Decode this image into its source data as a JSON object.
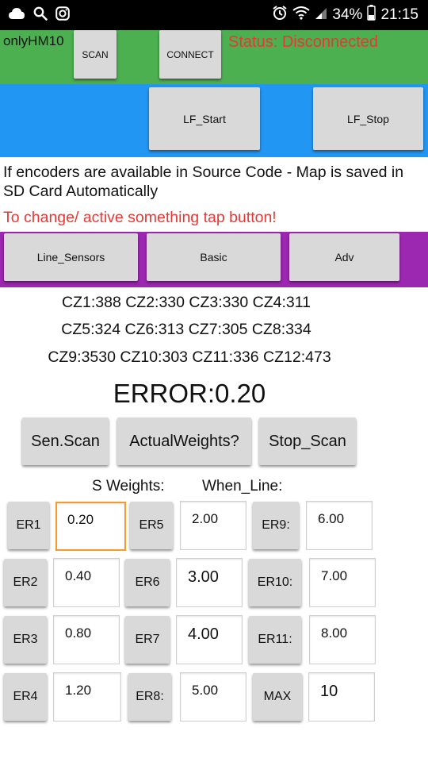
{
  "status_bar": {
    "battery": "34%",
    "time": "21:15",
    "icons": [
      "cloud-icon",
      "search-icon",
      "instagram-icon",
      "alarm-icon",
      "wifi-icon",
      "signal-icon",
      "battery-icon"
    ]
  },
  "top": {
    "device_name": "onlyHM10",
    "scan_label": "SCAN",
    "connect_label": "CONNECT",
    "status_text": "Status: Disconnected"
  },
  "control": {
    "lf_start_label": "LF_Start",
    "lf_stop_label": "LF_Stop"
  },
  "info": {
    "text": "If  encoders are available in Source Code - Map is saved in SD Card Automatically",
    "hint": "To change/ active something tap button!"
  },
  "tabs": {
    "line_sensors": "Line_Sensors",
    "basic": "Basic",
    "adv": "Adv"
  },
  "readings": {
    "row1": "CZ1:388 CZ2:330 CZ3:330 CZ4:311",
    "row2": "CZ5:324 CZ6:313 CZ7:305 CZ8:334",
    "row3": "CZ9:3530 CZ10:303 CZ11:336 CZ12:473",
    "error": "ERROR:0.20"
  },
  "actions": {
    "sen_scan": "Sen.Scan",
    "actual_weights": "ActualWeights?",
    "stop_scan": "Stop_Scan"
  },
  "weights_header": {
    "s_weights": "S Weights:",
    "when_line": "When_Line:"
  },
  "weights": {
    "er1": {
      "label": "ER1",
      "value": "0.20"
    },
    "er2": {
      "label": "ER2",
      "value": "0.40"
    },
    "er3": {
      "label": "ER3",
      "value": "0.80"
    },
    "er4": {
      "label": "ER4",
      "value": "1.20"
    },
    "er5": {
      "label": "ER5",
      "value": "2.00"
    },
    "er6": {
      "label": "ER6",
      "value": "3.00"
    },
    "er7": {
      "label": "ER7",
      "value": "4.00"
    },
    "er8": {
      "label": "ER8:",
      "value": "5.00"
    },
    "er9": {
      "label": "ER9:",
      "value": "6.00"
    },
    "er10": {
      "label": "ER10:",
      "value": "7.00"
    },
    "er11": {
      "label": "ER11:",
      "value": "8.00"
    },
    "max": {
      "label": "MAX",
      "value": "10"
    }
  },
  "colors": {
    "green_bar": "#4caf50",
    "blue_bar": "#2196f3",
    "purple_bar": "#9c27b0",
    "status_red": "#e53935",
    "focus_orange": "#f39c2b"
  }
}
